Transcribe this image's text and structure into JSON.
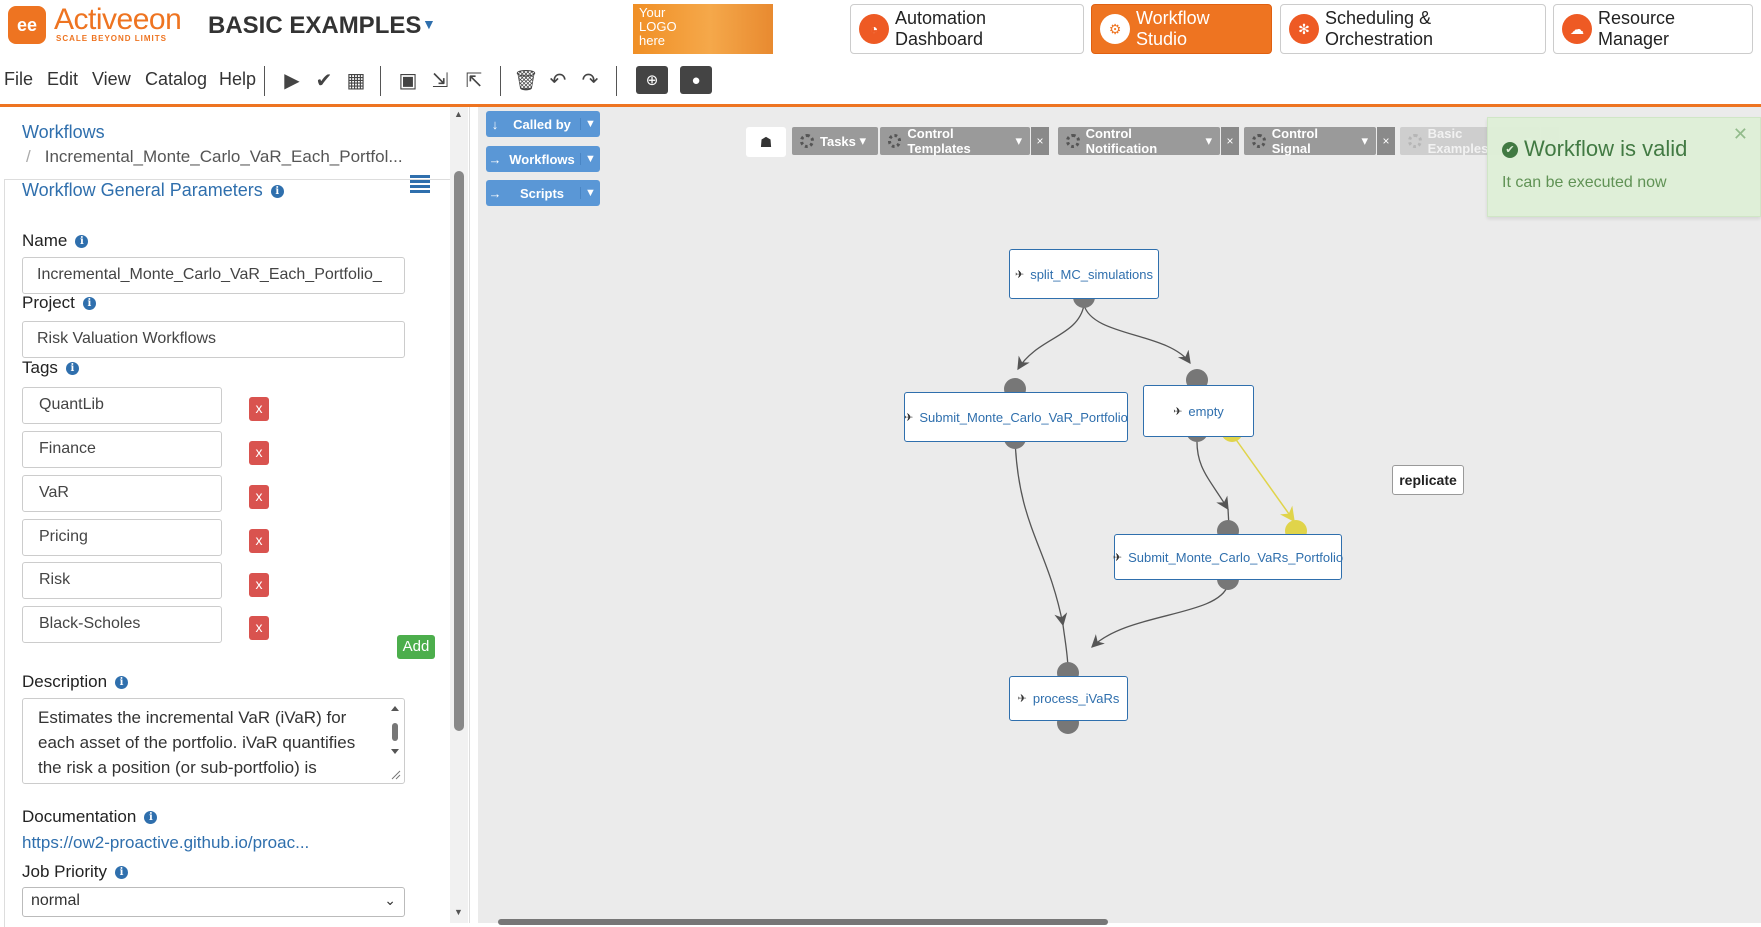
{
  "header": {
    "brand_name": "Activeeon",
    "brand_tagline": "SCALE BEYOND LIMITS",
    "bucket_title": "BASIC EXAMPLES",
    "custom_logo_text": "Your LOGO here",
    "portals": [
      {
        "label": "Automation Dashboard",
        "icon": "gauge-icon"
      },
      {
        "label": "Workflow Studio",
        "icon": "studio-icon",
        "active": true
      },
      {
        "label": "Scheduling & Orchestration",
        "icon": "gears-icon"
      },
      {
        "label": "Resource Manager",
        "icon": "cloud-icon"
      }
    ]
  },
  "menu": {
    "items": [
      "File",
      "Edit",
      "View",
      "Catalog",
      "Help"
    ],
    "toolbar_icons": [
      "play-icon",
      "check-icon",
      "calendar-icon",
      "save-icon",
      "import-icon",
      "export-icon",
      "trash-icon",
      "undo-icon",
      "redo-icon",
      "globe-folder-icon",
      "user-folder-icon"
    ]
  },
  "left_panel": {
    "breadcrumb": {
      "root": "Workflows",
      "current": "Incremental_Monte_Carlo_VaR_Each_Portfol..."
    },
    "section_title": "Workflow General Parameters",
    "name_label": "Name",
    "name_value": "Incremental_Monte_Carlo_VaR_Each_Portfolio_",
    "project_label": "Project",
    "project_value": "Risk Valuation Workflows",
    "tags_label": "Tags",
    "tags": [
      "QuantLib",
      "Finance",
      "VaR",
      "Pricing",
      "Risk",
      "Black-Scholes"
    ],
    "tag_remove_label": "x",
    "add_label": "Add",
    "description_label": "Description",
    "description_value": "Estimates the incremental VaR (iVaR) for each asset of the portfolio. iVaR quantifies the risk a position (or sub-portfolio) is",
    "documentation_label": "Documentation",
    "documentation_link": "https://ow2-proactive.github.io/proac...",
    "priority_label": "Job Priority",
    "priority_value": "normal"
  },
  "canvas": {
    "side_buttons": [
      "Called by",
      "Workflows",
      "Scripts"
    ],
    "palette": [
      {
        "label": "Tasks",
        "closable": false
      },
      {
        "label": "Control Templates",
        "closable": true
      },
      {
        "label": "Control Notification",
        "closable": true
      },
      {
        "label": "Control Signal",
        "closable": true
      },
      {
        "label": "Basic Examples",
        "closable": true
      }
    ],
    "palette_close_label": "×",
    "notification": {
      "title": "Workflow is valid",
      "subtitle": "It can be executed now",
      "close": "✕"
    },
    "tasks": {
      "split": "split_MC_simulations",
      "submit_var": "Submit_Monte_Carlo_VaR_Portfolio",
      "empty": "empty",
      "submit_vars": "Submit_Monte_Carlo_VaRs_Portfolio",
      "process": "process_iVaRs"
    },
    "replicate_label": "replicate",
    "colors": {
      "accent": "#ee7421",
      "link": "#2f6fad",
      "replicate": "#e0d44a",
      "edge": "#555555"
    }
  }
}
